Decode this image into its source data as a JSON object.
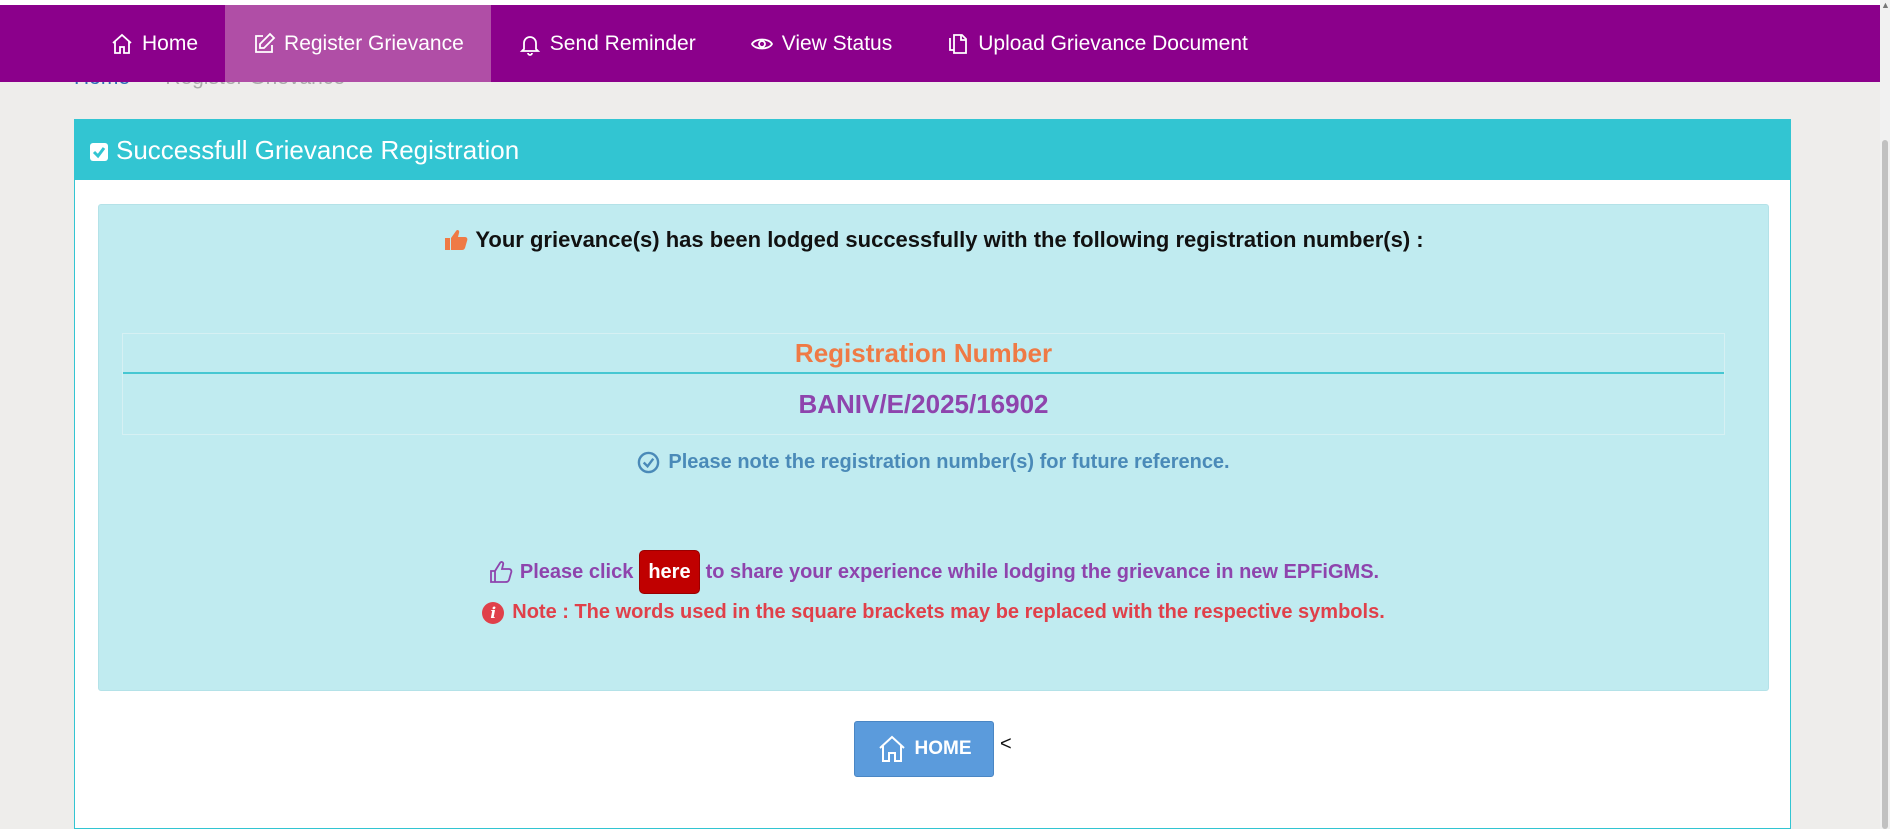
{
  "nav": {
    "items": [
      {
        "label": "Home",
        "icon": "home-icon"
      },
      {
        "label": "Register Grievance",
        "icon": "edit-icon",
        "active": true
      },
      {
        "label": "Send Reminder",
        "icon": "bell-icon"
      },
      {
        "label": "View Status",
        "icon": "eye-icon"
      },
      {
        "label": "Upload Grievance Document",
        "icon": "document-icon"
      }
    ]
  },
  "breadcrumb": {
    "home": "Home",
    "current": "Register Grievance"
  },
  "panel": {
    "title": "Successfull Grievance Registration",
    "lodged_message": "Your grievance(s) has been lodged successfully with the following registration number(s) :",
    "table_header": "Registration Number",
    "registration_number": "BANIV/E/2025/16902",
    "note_reference": "Please note the registration number(s) for future reference.",
    "click_prefix": "Please click",
    "here_label": "here",
    "click_suffix": "to share your experience while lodging the grievance in new EPFiGMS.",
    "note_brackets": "Note : The words used in the square brackets may be replaced with the respective symbols.",
    "home_button": "HOME",
    "stray_text": "<"
  },
  "colors": {
    "nav_bg": "#8b008b",
    "nav_active": "#b04ea6",
    "panel_heading": "#32c5d2",
    "alert_bg": "#c0ebf0",
    "reg_header": "#ef7a45",
    "reg_number": "#8e44ad",
    "here_button": "#c00000",
    "home_button": "#5b9bdc",
    "warning_text": "#e0404a"
  }
}
